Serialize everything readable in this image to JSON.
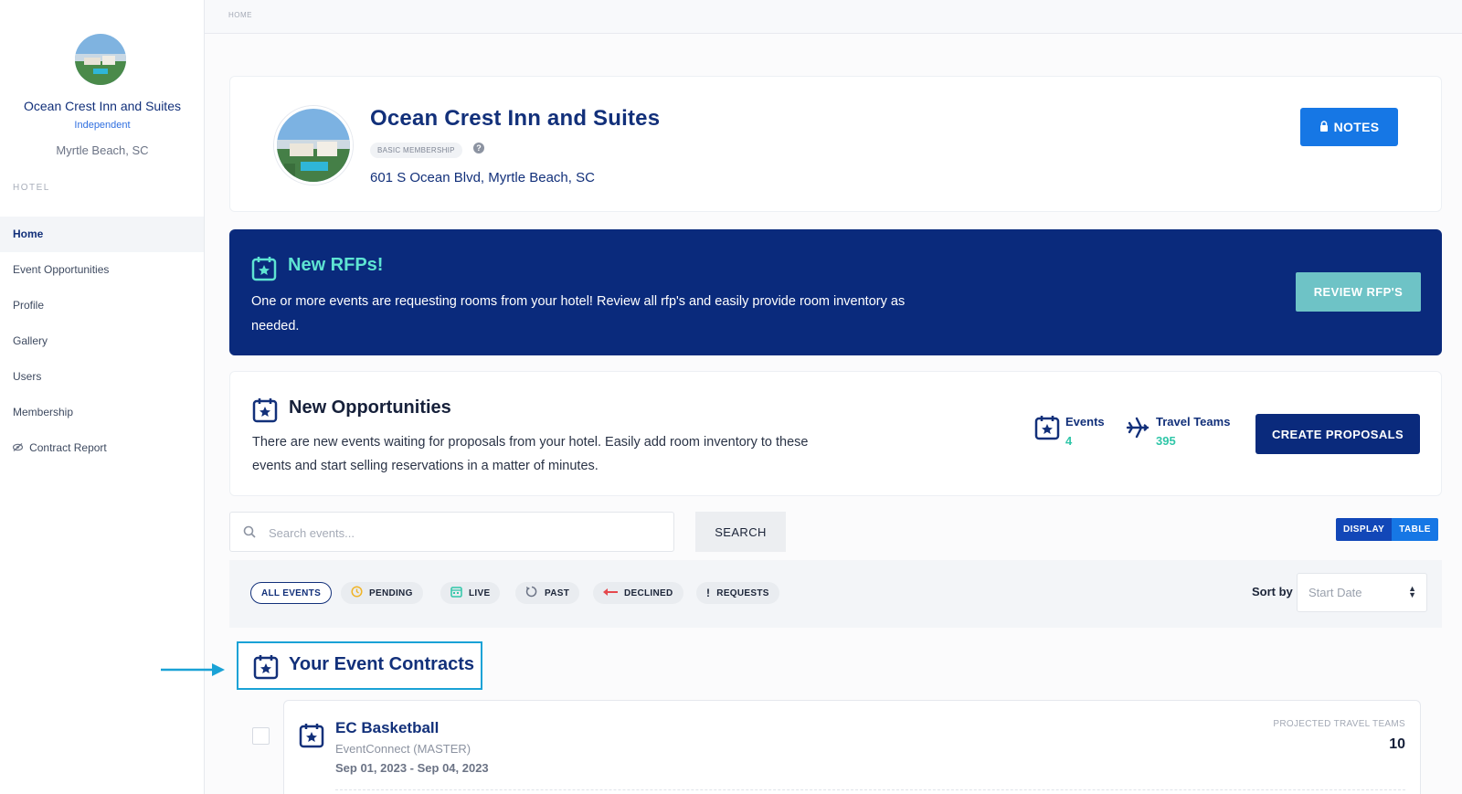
{
  "sidebar": {
    "hotel_name": "Ocean Crest Inn and Suites",
    "hotel_type": "Independent",
    "location": "Myrtle Beach, SC",
    "section_label": "HOTEL",
    "items": [
      {
        "label": "Home",
        "active": true
      },
      {
        "label": "Event Opportunities"
      },
      {
        "label": "Profile"
      },
      {
        "label": "Gallery"
      },
      {
        "label": "Users"
      },
      {
        "label": "Membership"
      },
      {
        "label": "Contract Report",
        "icon": "eye-slash-icon"
      }
    ]
  },
  "breadcrumb": "HOME",
  "hotel": {
    "name": "Ocean Crest Inn and Suites",
    "membership": "BASIC MEMBERSHIP",
    "address": "601 S Ocean Blvd, Myrtle Beach, SC",
    "notes_label": "NOTES"
  },
  "rfp_banner": {
    "title": "New RFPs!",
    "text": "One or more events are requesting rooms from your hotel! Review all rfp's and easily provide room inventory as needed.",
    "button": "REVIEW RFP'S"
  },
  "opportunities": {
    "title": "New Opportunities",
    "text": "There are new events waiting for proposals from your hotel. Easily add room inventory to these events and start selling reservations in a matter of minutes.",
    "events_label": "Events",
    "events_value": "4",
    "teams_label": "Travel Teams",
    "teams_value": "395",
    "button": "CREATE PROPOSALS"
  },
  "search": {
    "placeholder": "Search events...",
    "button": "SEARCH"
  },
  "view_toggle": {
    "display": "DISPLAY",
    "table": "TABLE"
  },
  "filters": [
    {
      "label": "ALL EVENTS",
      "active": true
    },
    {
      "label": "PENDING",
      "icon": "clock-icon"
    },
    {
      "label": "LIVE",
      "icon": "calendar-icon"
    },
    {
      "label": "PAST",
      "icon": "history-icon"
    },
    {
      "label": "DECLINED",
      "icon": "arrow-left-icon"
    },
    {
      "label": "REQUESTS",
      "icon": "exclamation-icon"
    }
  ],
  "sort": {
    "label": "Sort by",
    "value": "Start Date"
  },
  "contracts": {
    "title": "Your Event Contracts"
  },
  "event": {
    "title": "EC Basketball",
    "org": "EventConnect (MASTER)",
    "dates": "Sep 01, 2023 - Sep 04, 2023",
    "projected_label": "PROJECTED TRAVEL TEAMS",
    "projected_value": "10"
  },
  "colors": {
    "navy": "#0a2a7c",
    "primary_blue": "#1677e5",
    "teal": "#5ee4d2",
    "green": "#2fc6a8",
    "callout": "#1aa2d6"
  }
}
